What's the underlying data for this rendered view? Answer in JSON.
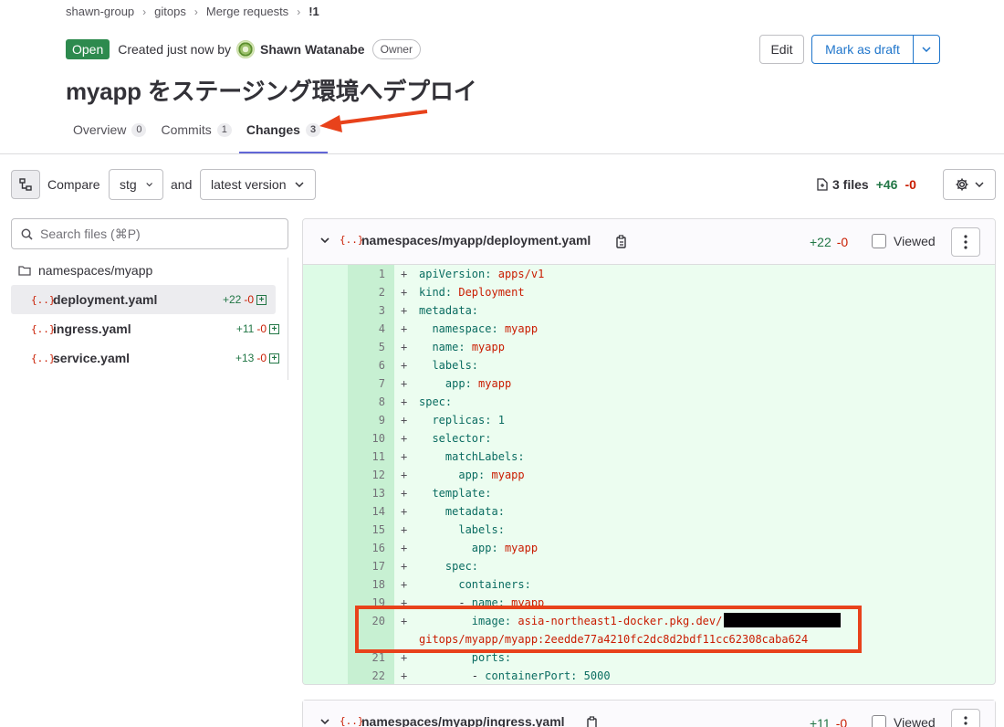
{
  "breadcrumb": [
    "shawn-group",
    "gitops",
    "Merge requests",
    "!1"
  ],
  "status": {
    "badge": "Open",
    "created_text": "Created just now by",
    "author": "Shawn Watanabe",
    "role": "Owner"
  },
  "actions": {
    "edit": "Edit",
    "draft": "Mark as draft"
  },
  "title": "myapp をステージング環境へデプロイ",
  "tabs": [
    {
      "label": "Overview",
      "count": "0"
    },
    {
      "label": "Commits",
      "count": "1"
    },
    {
      "label": "Changes",
      "count": "3"
    }
  ],
  "toolbar": {
    "compare_label": "Compare",
    "base": "stg",
    "and_label": "and",
    "head": "latest version",
    "files": "3 files",
    "added": "+46",
    "removed": "-0"
  },
  "search": {
    "placeholder": "Search files (⌘P)"
  },
  "tree": {
    "folder": "namespaces/myapp",
    "files": [
      {
        "name": "deployment.yaml",
        "added": "+22",
        "removed": "-0"
      },
      {
        "name": "ingress.yaml",
        "added": "+11",
        "removed": "-0"
      },
      {
        "name": "service.yaml",
        "added": "+13",
        "removed": "-0"
      }
    ]
  },
  "diff1": {
    "icon": "{..}",
    "path": "namespaces/myapp/deployment.yaml",
    "added": "+22",
    "removed": "-0",
    "viewed": "Viewed"
  },
  "diff2": {
    "icon": "{..}",
    "path": "namespaces/myapp/ingress.yaml",
    "added": "+11",
    "removed": "-0",
    "viewed": "Viewed"
  },
  "colors": {
    "open": "#2d8a4e",
    "accent": "#1f75cb",
    "tab_active": "#6166d6",
    "annotation": "#e8421b",
    "added_bg": "#ecfdf0"
  },
  "code_lines": [
    {
      "n": "1",
      "indent": "",
      "key": "apiVersion",
      "val": "apps/v1",
      "vt": "str"
    },
    {
      "n": "2",
      "indent": "",
      "key": "kind",
      "val": "Deployment",
      "vt": "str"
    },
    {
      "n": "3",
      "indent": "",
      "key": "metadata",
      "val": "",
      "vt": ""
    },
    {
      "n": "4",
      "indent": "  ",
      "key": "namespace",
      "val": "myapp",
      "vt": "str"
    },
    {
      "n": "5",
      "indent": "  ",
      "key": "name",
      "val": "myapp",
      "vt": "str"
    },
    {
      "n": "6",
      "indent": "  ",
      "key": "labels",
      "val": "",
      "vt": ""
    },
    {
      "n": "7",
      "indent": "    ",
      "key": "app",
      "val": "myapp",
      "vt": "str"
    },
    {
      "n": "8",
      "indent": "",
      "key": "spec",
      "val": "",
      "vt": ""
    },
    {
      "n": "9",
      "indent": "  ",
      "key": "replicas",
      "val": "1",
      "vt": "num"
    },
    {
      "n": "10",
      "indent": "  ",
      "key": "selector",
      "val": "",
      "vt": ""
    },
    {
      "n": "11",
      "indent": "    ",
      "key": "matchLabels",
      "val": "",
      "vt": ""
    },
    {
      "n": "12",
      "indent": "      ",
      "key": "app",
      "val": "myapp",
      "vt": "str"
    },
    {
      "n": "13",
      "indent": "  ",
      "key": "template",
      "val": "",
      "vt": ""
    },
    {
      "n": "14",
      "indent": "    ",
      "key": "metadata",
      "val": "",
      "vt": ""
    },
    {
      "n": "15",
      "indent": "      ",
      "key": "labels",
      "val": "",
      "vt": ""
    },
    {
      "n": "16",
      "indent": "        ",
      "key": "app",
      "val": "myapp",
      "vt": "str"
    },
    {
      "n": "17",
      "indent": "    ",
      "key": "spec",
      "val": "",
      "vt": ""
    },
    {
      "n": "18",
      "indent": "      ",
      "key": "containers",
      "val": "",
      "vt": ""
    },
    {
      "n": "19",
      "indent": "      - ",
      "key": "name",
      "val": "myapp",
      "vt": "str"
    },
    {
      "n": "20",
      "indent": "        ",
      "key": "image",
      "val": "asia-northeast1-docker.pkg.dev/",
      "vt": "str",
      "redacted": true,
      "cont": "gitops/myapp/myapp:2eedde77a4210fc2dc8d2bdf11cc62308caba624"
    },
    {
      "n": "21",
      "indent": "        ",
      "key": "ports",
      "val": "",
      "vt": ""
    },
    {
      "n": "22",
      "indent": "        - ",
      "key": "containerPort",
      "val": "5000",
      "vt": "num"
    }
  ]
}
